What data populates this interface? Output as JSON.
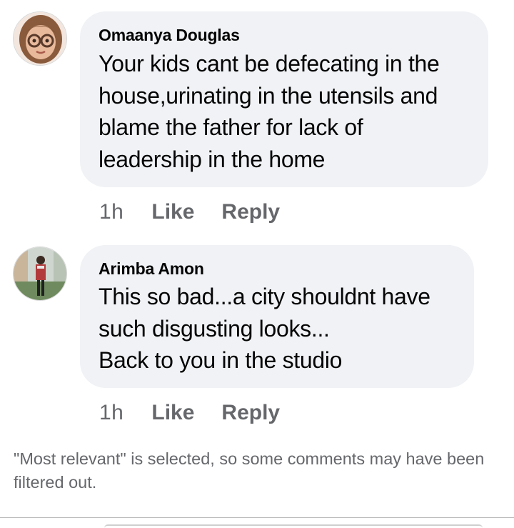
{
  "comments": [
    {
      "author": "Omaanya Douglas",
      "avatar_icon": "cartoon-woman-glasses-avatar",
      "text": "Your kids cant be defecating in the\nhouse,urinating in the utensils and\nblame the father for lack of\nleadership in the home",
      "time": "1h",
      "like_label": "Like",
      "reply_label": "Reply"
    },
    {
      "author": "Arimba Amon",
      "avatar_icon": "person-photo-avatar",
      "text": "This so bad...a city shouldnt have\nsuch disgusting looks...\nBack to you in the studio",
      "time": "1h",
      "like_label": "Like",
      "reply_label": "Reply"
    }
  ],
  "filter_note": "\"Most relevant\" is selected, so some comments may have been filtered out.",
  "colors": {
    "bubble_bg": "#f0f2f5",
    "secondary_text": "#65676b",
    "primary_text": "#050505"
  }
}
